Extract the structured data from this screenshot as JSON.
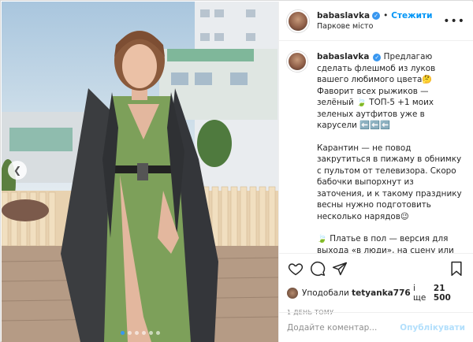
{
  "post": {
    "username": "babaslavka",
    "follow_label": "Стежити",
    "separator": "•",
    "location": "Паркове місто",
    "more_label": "•••",
    "caption_paragraphs": [
      "Предлагаю сделать флешмоб из луков вашего любимого цвета🤔 Фаворит всех рыжиков — зелёный 🍃 ТОП-5 +1 моих зеленых аутфитов уже в карусели ⬅️⬅️⬅️",
      "Карантин — не повод закрутиться в пижаму в обнимку с пультом от телевизора. Скоро бабочки выпорхнут из заточения, и к такому празднику весны нужно подготовить несколько нарядов😉",
      "🍃 Платье в пол — версия для выхода «в люди», на сцену или на фотосессию;\n🍃 А вот это же платье + грубый мужской пиджак — обычный выход в люди"
    ],
    "likes": {
      "prefix": "Уподобали",
      "user": "tetyanka776",
      "middle": "і ще",
      "count": "21 500"
    },
    "time_ago": "1 ДЕНЬ ТОМУ",
    "comment_placeholder": "Додайте коментар...",
    "publish_label": "Опублікувати"
  },
  "carousel": {
    "total_slides": 6,
    "active_index": 0
  },
  "icons": {
    "verified": "verified-badge-icon",
    "like": "heart-icon",
    "comment": "comment-icon",
    "share": "paper-plane-icon",
    "save": "bookmark-icon",
    "prev": "chevron-left-icon"
  },
  "colors": {
    "accent": "#0095f6",
    "publish_disabled": "#b2dffc",
    "muted": "#8e8e8e",
    "dress": "#7da05a",
    "coat": "#3b3d40"
  }
}
